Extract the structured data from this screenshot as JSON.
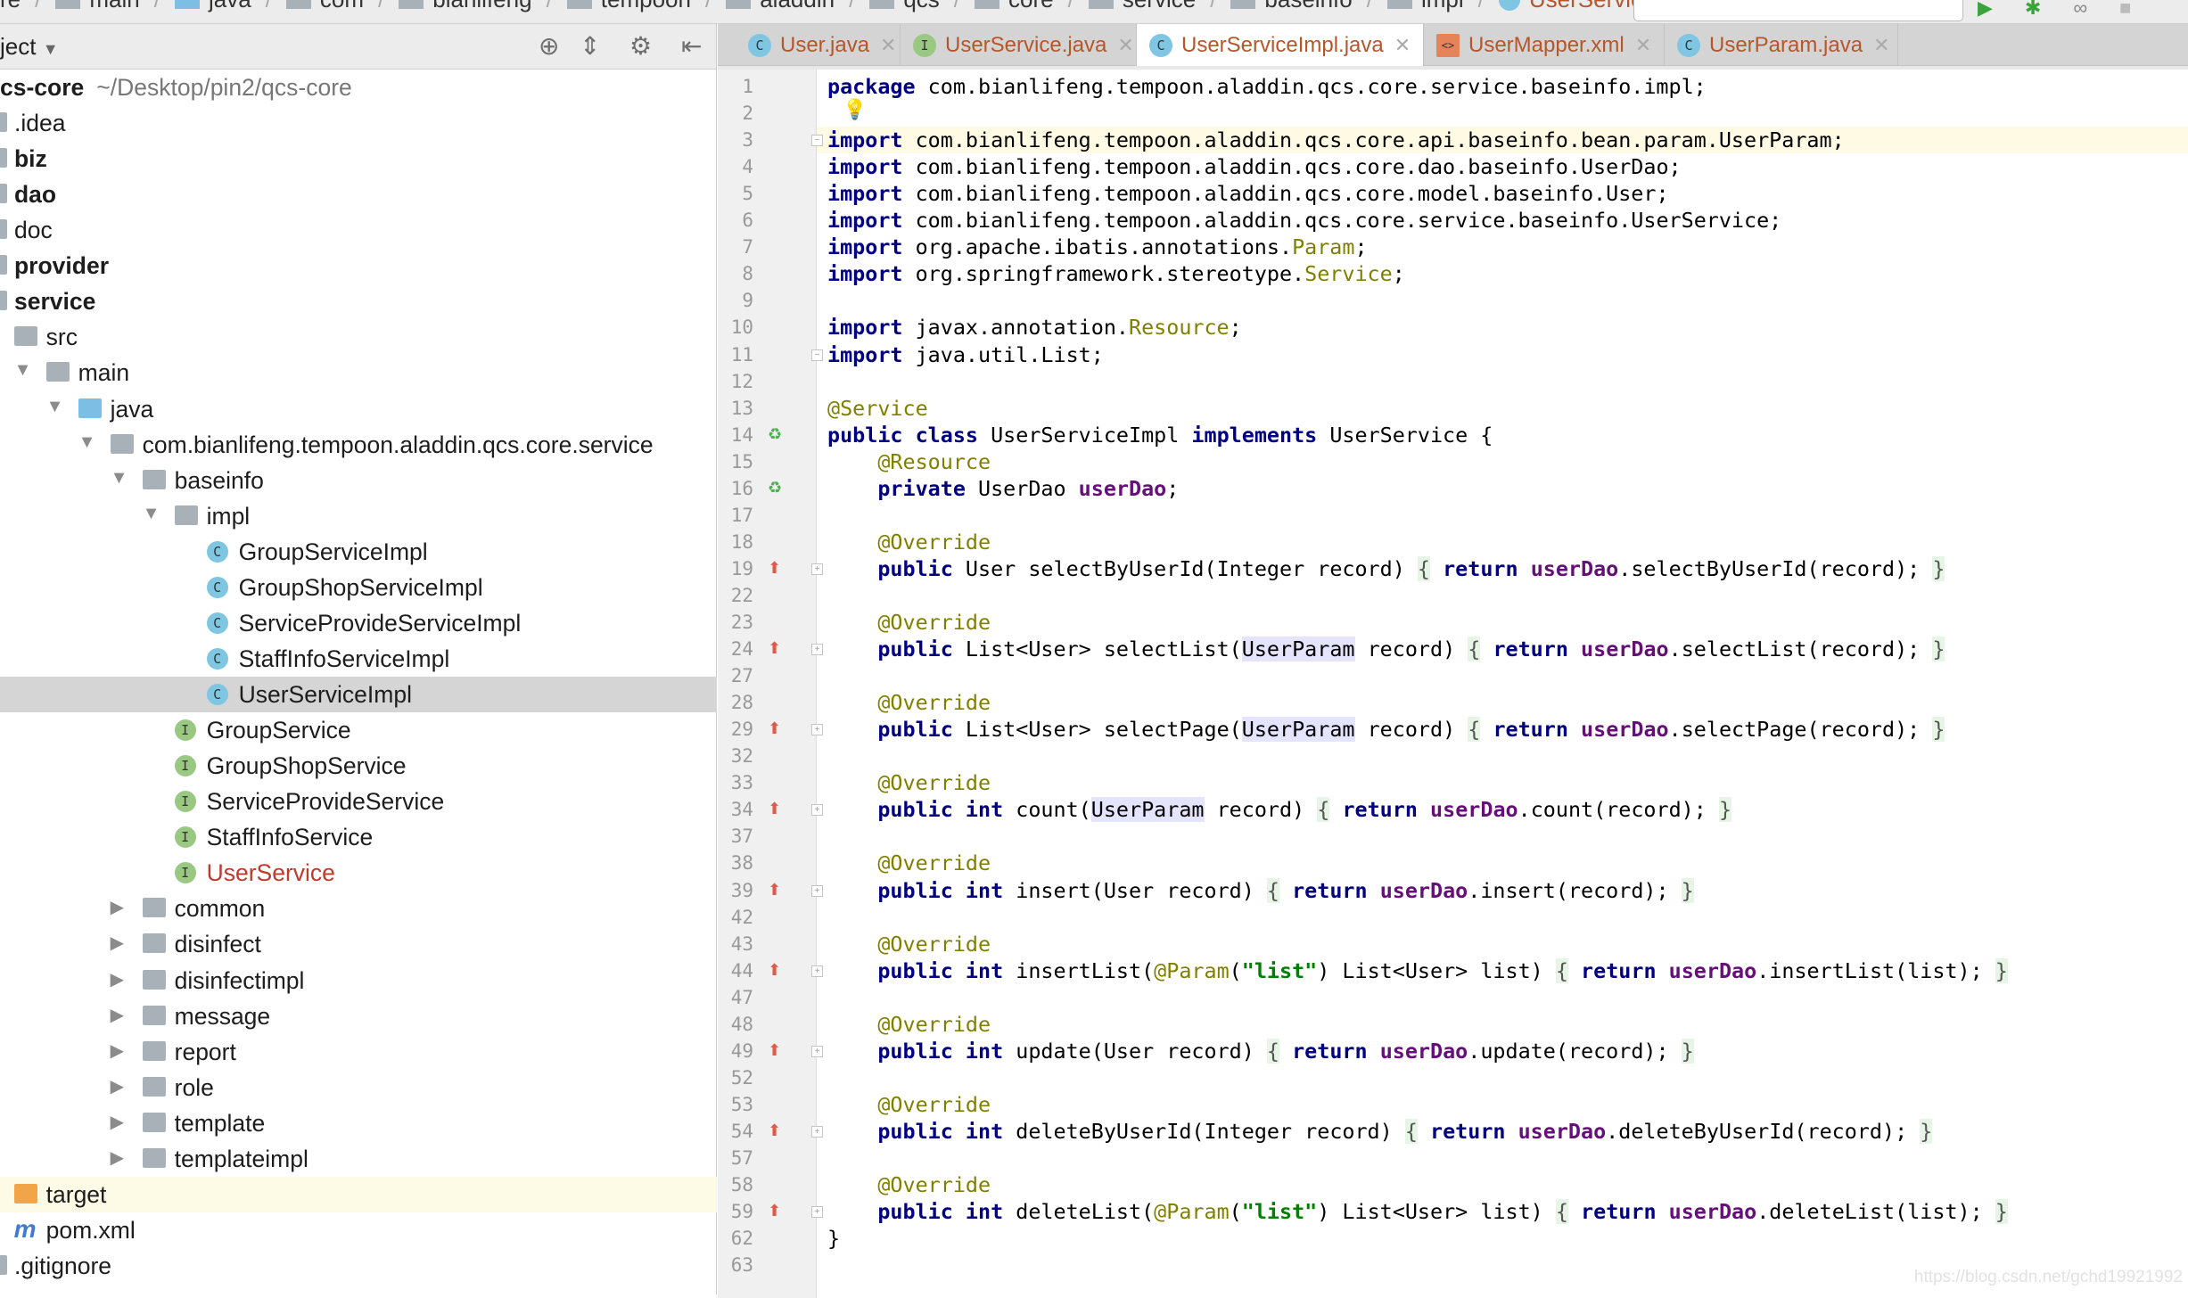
{
  "breadcrumb": [
    "re",
    "main",
    "java",
    "com",
    "bianlifeng",
    "tempoon",
    "aladdin",
    "qcs",
    "core",
    "service",
    "baseinfo",
    "impl",
    "UserServiceImpl"
  ],
  "project_panel": {
    "title": "ject",
    "dropdown_icon": "caret-down",
    "toolbar_icons": [
      "locate-icon",
      "collapse-all-icon",
      "gear-icon",
      "hide-panel-icon"
    ],
    "tree": [
      {
        "label": "cs-core",
        "path": "~/Desktop/pin2/qcs-core",
        "depth": -1,
        "bold": true
      },
      {
        "label": ".idea",
        "depth": 0,
        "icon": "folder"
      },
      {
        "label": "biz",
        "depth": 0,
        "icon": "module",
        "bold": true
      },
      {
        "label": "dao",
        "depth": 0,
        "icon": "module",
        "bold": true
      },
      {
        "label": "doc",
        "depth": 0,
        "icon": "folder"
      },
      {
        "label": "provider",
        "depth": 0,
        "icon": "module",
        "bold": true
      },
      {
        "label": "service",
        "depth": 0,
        "icon": "module",
        "bold": true
      },
      {
        "label": "src",
        "depth": 1,
        "icon": "folder"
      },
      {
        "label": "main",
        "depth": 2,
        "icon": "folder",
        "arrow": "open"
      },
      {
        "label": "java",
        "depth": 3,
        "icon": "source-folder",
        "arrow": "open"
      },
      {
        "label": "com.bianlifeng.tempoon.aladdin.qcs.core.service",
        "depth": 4,
        "icon": "package",
        "arrow": "open"
      },
      {
        "label": "baseinfo",
        "depth": 5,
        "icon": "package",
        "arrow": "open"
      },
      {
        "label": "impl",
        "depth": 6,
        "icon": "package",
        "arrow": "open"
      },
      {
        "label": "GroupServiceImpl",
        "depth": 7,
        "icon": "class"
      },
      {
        "label": "GroupShopServiceImpl",
        "depth": 7,
        "icon": "class"
      },
      {
        "label": "ServiceProvideServiceImpl",
        "depth": 7,
        "icon": "class"
      },
      {
        "label": "StaffInfoServiceImpl",
        "depth": 7,
        "icon": "class"
      },
      {
        "label": "UserServiceImpl",
        "depth": 7,
        "icon": "class",
        "selected": true
      },
      {
        "label": "GroupService",
        "depth": 6,
        "icon": "interface"
      },
      {
        "label": "GroupShopService",
        "depth": 6,
        "icon": "interface"
      },
      {
        "label": "ServiceProvideService",
        "depth": 6,
        "icon": "interface"
      },
      {
        "label": "StaffInfoService",
        "depth": 6,
        "icon": "interface"
      },
      {
        "label": "UserService",
        "depth": 6,
        "icon": "interface",
        "color": "#c0392b"
      },
      {
        "label": "common",
        "depth": 5,
        "icon": "package",
        "arrow": "closed"
      },
      {
        "label": "disinfect",
        "depth": 5,
        "icon": "package",
        "arrow": "closed"
      },
      {
        "label": "disinfectimpl",
        "depth": 5,
        "icon": "package",
        "arrow": "closed"
      },
      {
        "label": "message",
        "depth": 5,
        "icon": "package",
        "arrow": "closed"
      },
      {
        "label": "report",
        "depth": 5,
        "icon": "package",
        "arrow": "closed"
      },
      {
        "label": "role",
        "depth": 5,
        "icon": "package",
        "arrow": "closed"
      },
      {
        "label": "template",
        "depth": 5,
        "icon": "package",
        "arrow": "closed"
      },
      {
        "label": "templateimpl",
        "depth": 5,
        "icon": "package",
        "arrow": "closed"
      },
      {
        "label": "target",
        "depth": 1,
        "icon": "target-folder",
        "highlight": true
      },
      {
        "label": "pom.xml",
        "depth": 1,
        "icon": "maven"
      },
      {
        "label": ".gitignore",
        "depth": 0,
        "icon": "file"
      }
    ]
  },
  "tabs": [
    {
      "label": "User.java",
      "icon": "class",
      "active": false
    },
    {
      "label": "UserService.java",
      "icon": "interface",
      "active": false
    },
    {
      "label": "UserServiceImpl.java",
      "icon": "class",
      "active": true
    },
    {
      "label": "UserMapper.xml",
      "icon": "xml",
      "active": false
    },
    {
      "label": "UserParam.java",
      "icon": "class",
      "active": false
    }
  ],
  "colors": {
    "keyword": "#000080",
    "annotation": "#808000",
    "field": "#660e7a",
    "string": "#008000",
    "tab_text": "#b5562b",
    "current_line": "#fffae3"
  },
  "current_line": 3,
  "code": [
    {
      "n": 1,
      "s": [
        [
          "kw",
          "package"
        ],
        [
          "",
          " com.bianlifeng.tempoon.aladdin.qcs.core.service.baseinfo.impl;"
        ]
      ]
    },
    {
      "n": 2,
      "s": []
    },
    {
      "n": 3,
      "fold": true,
      "s": [
        [
          "kw",
          "import"
        ],
        [
          "",
          " com.bianlifeng.tempoon.aladdin.qcs.core.api.baseinfo.bean.param.UserParam;"
        ]
      ]
    },
    {
      "n": 4,
      "s": [
        [
          "kw",
          "import"
        ],
        [
          "",
          " com.bianlifeng.tempoon.aladdin.qcs.core.dao.baseinfo.UserDao;"
        ]
      ]
    },
    {
      "n": 5,
      "s": [
        [
          "kw",
          "import"
        ],
        [
          "",
          " com.bianlifeng.tempoon.aladdin.qcs.core.model.baseinfo.User;"
        ]
      ]
    },
    {
      "n": 6,
      "s": [
        [
          "kw",
          "import"
        ],
        [
          "",
          " com.bianlifeng.tempoon.aladdin.qcs.core.service.baseinfo.UserService;"
        ]
      ]
    },
    {
      "n": 7,
      "s": [
        [
          "kw",
          "import"
        ],
        [
          "",
          " org.apache.ibatis.annotations."
        ],
        [
          "ann",
          "Param"
        ],
        [
          "",
          ";"
        ]
      ]
    },
    {
      "n": 8,
      "s": [
        [
          "kw",
          "import"
        ],
        [
          "",
          " org.springframework.stereotype."
        ],
        [
          "ann",
          "Service"
        ],
        [
          "",
          ";"
        ]
      ]
    },
    {
      "n": 9,
      "s": []
    },
    {
      "n": 10,
      "s": [
        [
          "kw",
          "import"
        ],
        [
          "",
          " javax.annotation."
        ],
        [
          "ann",
          "Resource"
        ],
        [
          "",
          ";"
        ]
      ]
    },
    {
      "n": 11,
      "fold": true,
      "s": [
        [
          "kw",
          "import"
        ],
        [
          "",
          " java.util.List;"
        ]
      ]
    },
    {
      "n": 12,
      "s": []
    },
    {
      "n": 13,
      "s": [
        [
          "ann",
          "@Service"
        ]
      ]
    },
    {
      "n": 14,
      "gutter": "spring-bean",
      "s": [
        [
          "kw",
          "public class"
        ],
        [
          "",
          " UserServiceImpl "
        ],
        [
          "kw",
          "implements"
        ],
        [
          "",
          " UserService {"
        ]
      ]
    },
    {
      "n": 15,
      "s": [
        [
          "",
          "    "
        ],
        [
          "ann",
          "@Resource"
        ]
      ]
    },
    {
      "n": 16,
      "gutter": "spring-bean",
      "s": [
        [
          "",
          "    "
        ],
        [
          "kw",
          "private"
        ],
        [
          "",
          " UserDao "
        ],
        [
          "fld",
          "userDao"
        ],
        [
          "",
          ";"
        ]
      ]
    },
    {
      "n": 17,
      "s": []
    },
    {
      "n": 18,
      "s": [
        [
          "",
          "    "
        ],
        [
          "ann",
          "@Override"
        ]
      ]
    },
    {
      "n": 19,
      "gutter": "override",
      "fold": true,
      "s": [
        [
          "",
          "    "
        ],
        [
          "kw",
          "public"
        ],
        [
          "",
          " User selectByUserId(Integer record) "
        ],
        [
          "br",
          "{"
        ],
        [
          "",
          " "
        ],
        [
          "kw",
          "return"
        ],
        [
          "",
          " "
        ],
        [
          "fld",
          "userDao"
        ],
        [
          "",
          ".selectByUserId(record); "
        ],
        [
          "br",
          "}"
        ]
      ]
    },
    {
      "n": 22,
      "s": []
    },
    {
      "n": 23,
      "s": [
        [
          "",
          "    "
        ],
        [
          "ann",
          "@Override"
        ]
      ]
    },
    {
      "n": 24,
      "gutter": "override",
      "fold": true,
      "s": [
        [
          "",
          "    "
        ],
        [
          "kw",
          "public"
        ],
        [
          "",
          " List<User> selectList("
        ],
        [
          "hlp",
          "UserParam"
        ],
        [
          "",
          " record) "
        ],
        [
          "br",
          "{"
        ],
        [
          "",
          " "
        ],
        [
          "kw",
          "return"
        ],
        [
          "",
          " "
        ],
        [
          "fld",
          "userDao"
        ],
        [
          "",
          ".selectList(record); "
        ],
        [
          "br",
          "}"
        ]
      ]
    },
    {
      "n": 27,
      "s": []
    },
    {
      "n": 28,
      "s": [
        [
          "",
          "    "
        ],
        [
          "ann",
          "@Override"
        ]
      ]
    },
    {
      "n": 29,
      "gutter": "override",
      "fold": true,
      "s": [
        [
          "",
          "    "
        ],
        [
          "kw",
          "public"
        ],
        [
          "",
          " List<User> selectPage("
        ],
        [
          "hlp",
          "UserParam"
        ],
        [
          "",
          " record) "
        ],
        [
          "br",
          "{"
        ],
        [
          "",
          " "
        ],
        [
          "kw",
          "return"
        ],
        [
          "",
          " "
        ],
        [
          "fld",
          "userDao"
        ],
        [
          "",
          ".selectPage(record); "
        ],
        [
          "br",
          "}"
        ]
      ]
    },
    {
      "n": 32,
      "s": []
    },
    {
      "n": 33,
      "s": [
        [
          "",
          "    "
        ],
        [
          "ann",
          "@Override"
        ]
      ]
    },
    {
      "n": 34,
      "gutter": "override",
      "fold": true,
      "s": [
        [
          "",
          "    "
        ],
        [
          "kw",
          "public int"
        ],
        [
          "",
          " count("
        ],
        [
          "hlp",
          "UserParam"
        ],
        [
          "",
          " record) "
        ],
        [
          "br",
          "{"
        ],
        [
          "",
          " "
        ],
        [
          "kw",
          "return"
        ],
        [
          "",
          " "
        ],
        [
          "fld",
          "userDao"
        ],
        [
          "",
          ".count(record); "
        ],
        [
          "br",
          "}"
        ]
      ]
    },
    {
      "n": 37,
      "s": []
    },
    {
      "n": 38,
      "s": [
        [
          "",
          "    "
        ],
        [
          "ann",
          "@Override"
        ]
      ]
    },
    {
      "n": 39,
      "gutter": "override",
      "fold": true,
      "s": [
        [
          "",
          "    "
        ],
        [
          "kw",
          "public int"
        ],
        [
          "",
          " insert(User record) "
        ],
        [
          "br",
          "{"
        ],
        [
          "",
          " "
        ],
        [
          "kw",
          "return"
        ],
        [
          "",
          " "
        ],
        [
          "fld",
          "userDao"
        ],
        [
          "",
          ".insert(record); "
        ],
        [
          "br",
          "}"
        ]
      ]
    },
    {
      "n": 42,
      "s": []
    },
    {
      "n": 43,
      "s": [
        [
          "",
          "    "
        ],
        [
          "ann",
          "@Override"
        ]
      ]
    },
    {
      "n": 44,
      "gutter": "override",
      "fold": true,
      "s": [
        [
          "",
          "    "
        ],
        [
          "kw",
          "public int"
        ],
        [
          "",
          " insertList("
        ],
        [
          "ann",
          "@Param"
        ],
        [
          "",
          "("
        ],
        [
          "str",
          "\"list\""
        ],
        [
          "",
          ") List<User> list) "
        ],
        [
          "br",
          "{"
        ],
        [
          "",
          " "
        ],
        [
          "kw",
          "return"
        ],
        [
          "",
          " "
        ],
        [
          "fld",
          "userDao"
        ],
        [
          "",
          ".insertList(list); "
        ],
        [
          "br",
          "}"
        ]
      ]
    },
    {
      "n": 47,
      "s": []
    },
    {
      "n": 48,
      "s": [
        [
          "",
          "    "
        ],
        [
          "ann",
          "@Override"
        ]
      ]
    },
    {
      "n": 49,
      "gutter": "override",
      "fold": true,
      "s": [
        [
          "",
          "    "
        ],
        [
          "kw",
          "public int"
        ],
        [
          "",
          " update(User record) "
        ],
        [
          "br",
          "{"
        ],
        [
          "",
          " "
        ],
        [
          "kw",
          "return"
        ],
        [
          "",
          " "
        ],
        [
          "fld",
          "userDao"
        ],
        [
          "",
          ".update(record); "
        ],
        [
          "br",
          "}"
        ]
      ]
    },
    {
      "n": 52,
      "s": []
    },
    {
      "n": 53,
      "s": [
        [
          "",
          "    "
        ],
        [
          "ann",
          "@Override"
        ]
      ]
    },
    {
      "n": 54,
      "gutter": "override",
      "fold": true,
      "s": [
        [
          "",
          "    "
        ],
        [
          "kw",
          "public int"
        ],
        [
          "",
          " deleteByUserId(Integer record) "
        ],
        [
          "br",
          "{"
        ],
        [
          "",
          " "
        ],
        [
          "kw",
          "return"
        ],
        [
          "",
          " "
        ],
        [
          "fld",
          "userDao"
        ],
        [
          "",
          ".deleteByUserId(record); "
        ],
        [
          "br",
          "}"
        ]
      ]
    },
    {
      "n": 57,
      "s": []
    },
    {
      "n": 58,
      "s": [
        [
          "",
          "    "
        ],
        [
          "ann",
          "@Override"
        ]
      ]
    },
    {
      "n": 59,
      "gutter": "override",
      "fold": true,
      "s": [
        [
          "",
          "    "
        ],
        [
          "kw",
          "public int"
        ],
        [
          "",
          " deleteList("
        ],
        [
          "ann",
          "@Param"
        ],
        [
          "",
          "("
        ],
        [
          "str",
          "\"list\""
        ],
        [
          "",
          ") List<User> list) "
        ],
        [
          "br",
          "{"
        ],
        [
          "",
          " "
        ],
        [
          "kw",
          "return"
        ],
        [
          "",
          " "
        ],
        [
          "fld",
          "userDao"
        ],
        [
          "",
          ".deleteList(list); "
        ],
        [
          "br",
          "}"
        ]
      ]
    },
    {
      "n": 62,
      "s": [
        [
          "",
          "}"
        ]
      ]
    },
    {
      "n": 63,
      "s": []
    }
  ],
  "watermark": "https://blog.csdn.net/gchd19921992"
}
